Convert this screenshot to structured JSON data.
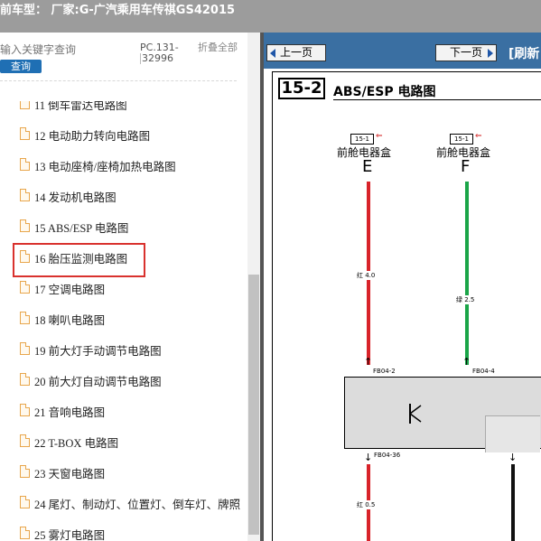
{
  "header": {
    "title": "前车型：  厂家:G-广汽乘用车传祺GS42015"
  },
  "search": {
    "placeholder": "输入关键字查询",
    "query_label": "查询"
  },
  "pc": {
    "line1": "PC.131-",
    "line2": "32996"
  },
  "collapse_label": "折叠全部",
  "items": [
    {
      "label": "11 倒车雷达电路图"
    },
    {
      "label": "12 电动助力转向电路图"
    },
    {
      "label": "13 电动座椅/座椅加热电路图"
    },
    {
      "label": "14 发动机电路图"
    },
    {
      "label": "15 ABS/ESP 电路图"
    },
    {
      "label": "16 胎压监测电路图"
    },
    {
      "label": "17 空调电路图"
    },
    {
      "label": "18 喇叭电路图"
    },
    {
      "label": "19 前大灯手动调节电路图"
    },
    {
      "label": "20 前大灯自动调节电路图"
    },
    {
      "label": "21 音响电路图"
    },
    {
      "label": "22 T-BOX 电路图"
    },
    {
      "label": "23 天窗电路图"
    },
    {
      "label": "24 尾灯、制动灯、位置灯、倒车灯、牌照"
    },
    {
      "label": "25 雾灯电路图"
    }
  ],
  "highlighted_index": 4,
  "nav": {
    "prev": "上一页",
    "next": "下一页",
    "refresh": "[刷新"
  },
  "sheet": {
    "number": "15-2",
    "title": "ABS/ESP 电路图",
    "ref1": "15-1",
    "ref2": "15-1",
    "box1_label": "前舱电器盒",
    "box1_letter": "E",
    "box2_label": "前舱电器盒",
    "box2_letter": "F",
    "wire1": "红 4.0",
    "wire2": "绿 2.5",
    "pin1": "FB04-2",
    "pin2": "FB04-4",
    "pin3": "FB04-36",
    "wire3": "红 0.5"
  },
  "colors": {
    "wire_red": "#d8232a",
    "wire_green": "#1aa548",
    "wire_black": "#111111",
    "nav_blue": "#3a6fa2",
    "highlight": "#d9322e"
  }
}
